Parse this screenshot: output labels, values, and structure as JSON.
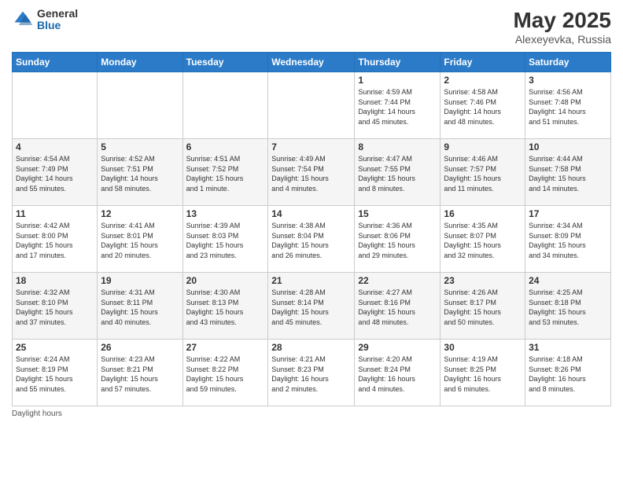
{
  "header": {
    "logo": {
      "general": "General",
      "blue": "Blue"
    },
    "title": "May 2025",
    "location": "Alexeyevka, Russia"
  },
  "calendar": {
    "days_of_week": [
      "Sunday",
      "Monday",
      "Tuesday",
      "Wednesday",
      "Thursday",
      "Friday",
      "Saturday"
    ],
    "weeks": [
      [
        {
          "day": "",
          "info": ""
        },
        {
          "day": "",
          "info": ""
        },
        {
          "day": "",
          "info": ""
        },
        {
          "day": "",
          "info": ""
        },
        {
          "day": "1",
          "info": "Sunrise: 4:59 AM\nSunset: 7:44 PM\nDaylight: 14 hours\nand 45 minutes."
        },
        {
          "day": "2",
          "info": "Sunrise: 4:58 AM\nSunset: 7:46 PM\nDaylight: 14 hours\nand 48 minutes."
        },
        {
          "day": "3",
          "info": "Sunrise: 4:56 AM\nSunset: 7:48 PM\nDaylight: 14 hours\nand 51 minutes."
        }
      ],
      [
        {
          "day": "4",
          "info": "Sunrise: 4:54 AM\nSunset: 7:49 PM\nDaylight: 14 hours\nand 55 minutes."
        },
        {
          "day": "5",
          "info": "Sunrise: 4:52 AM\nSunset: 7:51 PM\nDaylight: 14 hours\nand 58 minutes."
        },
        {
          "day": "6",
          "info": "Sunrise: 4:51 AM\nSunset: 7:52 PM\nDaylight: 15 hours\nand 1 minute."
        },
        {
          "day": "7",
          "info": "Sunrise: 4:49 AM\nSunset: 7:54 PM\nDaylight: 15 hours\nand 4 minutes."
        },
        {
          "day": "8",
          "info": "Sunrise: 4:47 AM\nSunset: 7:55 PM\nDaylight: 15 hours\nand 8 minutes."
        },
        {
          "day": "9",
          "info": "Sunrise: 4:46 AM\nSunset: 7:57 PM\nDaylight: 15 hours\nand 11 minutes."
        },
        {
          "day": "10",
          "info": "Sunrise: 4:44 AM\nSunset: 7:58 PM\nDaylight: 15 hours\nand 14 minutes."
        }
      ],
      [
        {
          "day": "11",
          "info": "Sunrise: 4:42 AM\nSunset: 8:00 PM\nDaylight: 15 hours\nand 17 minutes."
        },
        {
          "day": "12",
          "info": "Sunrise: 4:41 AM\nSunset: 8:01 PM\nDaylight: 15 hours\nand 20 minutes."
        },
        {
          "day": "13",
          "info": "Sunrise: 4:39 AM\nSunset: 8:03 PM\nDaylight: 15 hours\nand 23 minutes."
        },
        {
          "day": "14",
          "info": "Sunrise: 4:38 AM\nSunset: 8:04 PM\nDaylight: 15 hours\nand 26 minutes."
        },
        {
          "day": "15",
          "info": "Sunrise: 4:36 AM\nSunset: 8:06 PM\nDaylight: 15 hours\nand 29 minutes."
        },
        {
          "day": "16",
          "info": "Sunrise: 4:35 AM\nSunset: 8:07 PM\nDaylight: 15 hours\nand 32 minutes."
        },
        {
          "day": "17",
          "info": "Sunrise: 4:34 AM\nSunset: 8:09 PM\nDaylight: 15 hours\nand 34 minutes."
        }
      ],
      [
        {
          "day": "18",
          "info": "Sunrise: 4:32 AM\nSunset: 8:10 PM\nDaylight: 15 hours\nand 37 minutes."
        },
        {
          "day": "19",
          "info": "Sunrise: 4:31 AM\nSunset: 8:11 PM\nDaylight: 15 hours\nand 40 minutes."
        },
        {
          "day": "20",
          "info": "Sunrise: 4:30 AM\nSunset: 8:13 PM\nDaylight: 15 hours\nand 43 minutes."
        },
        {
          "day": "21",
          "info": "Sunrise: 4:28 AM\nSunset: 8:14 PM\nDaylight: 15 hours\nand 45 minutes."
        },
        {
          "day": "22",
          "info": "Sunrise: 4:27 AM\nSunset: 8:16 PM\nDaylight: 15 hours\nand 48 minutes."
        },
        {
          "day": "23",
          "info": "Sunrise: 4:26 AM\nSunset: 8:17 PM\nDaylight: 15 hours\nand 50 minutes."
        },
        {
          "day": "24",
          "info": "Sunrise: 4:25 AM\nSunset: 8:18 PM\nDaylight: 15 hours\nand 53 minutes."
        }
      ],
      [
        {
          "day": "25",
          "info": "Sunrise: 4:24 AM\nSunset: 8:19 PM\nDaylight: 15 hours\nand 55 minutes."
        },
        {
          "day": "26",
          "info": "Sunrise: 4:23 AM\nSunset: 8:21 PM\nDaylight: 15 hours\nand 57 minutes."
        },
        {
          "day": "27",
          "info": "Sunrise: 4:22 AM\nSunset: 8:22 PM\nDaylight: 15 hours\nand 59 minutes."
        },
        {
          "day": "28",
          "info": "Sunrise: 4:21 AM\nSunset: 8:23 PM\nDaylight: 16 hours\nand 2 minutes."
        },
        {
          "day": "29",
          "info": "Sunrise: 4:20 AM\nSunset: 8:24 PM\nDaylight: 16 hours\nand 4 minutes."
        },
        {
          "day": "30",
          "info": "Sunrise: 4:19 AM\nSunset: 8:25 PM\nDaylight: 16 hours\nand 6 minutes."
        },
        {
          "day": "31",
          "info": "Sunrise: 4:18 AM\nSunset: 8:26 PM\nDaylight: 16 hours\nand 8 minutes."
        }
      ]
    ]
  },
  "footer": {
    "note": "Daylight hours"
  }
}
